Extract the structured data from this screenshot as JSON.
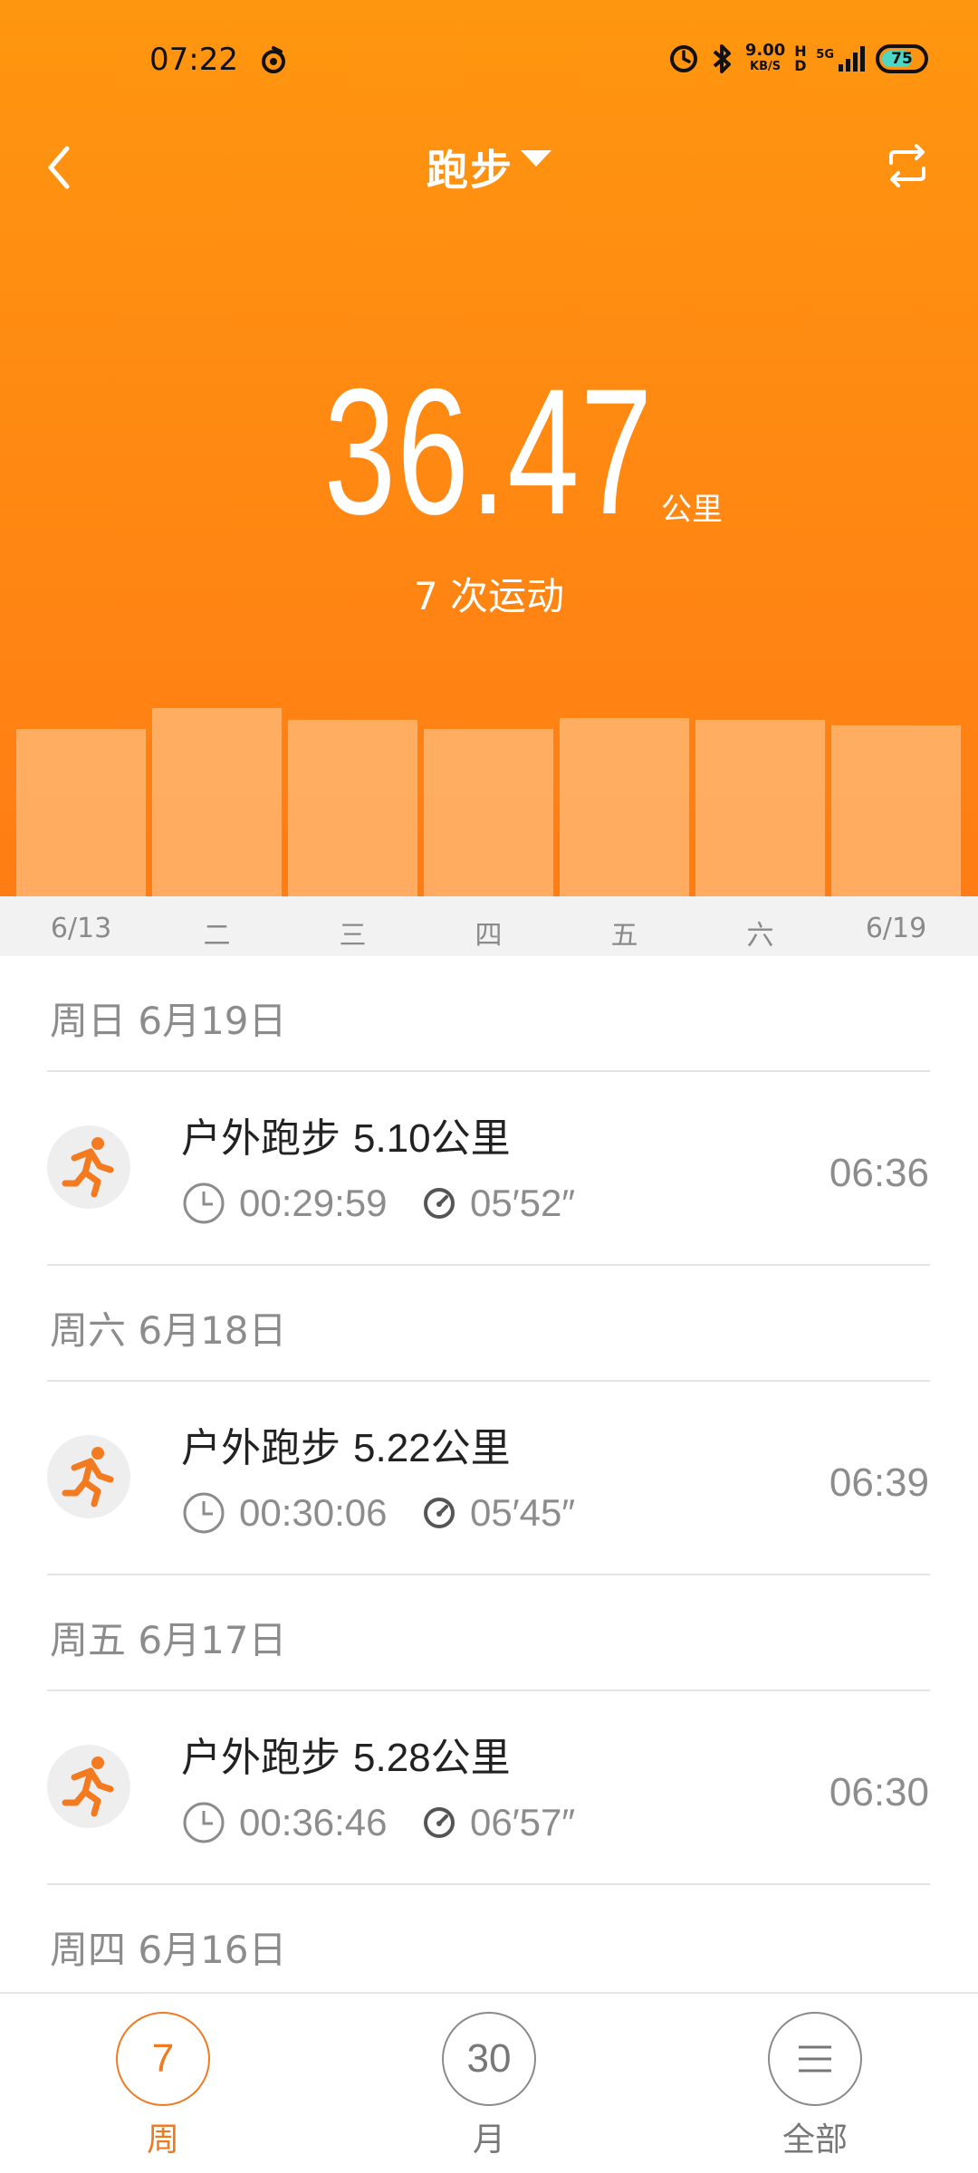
{
  "colors": {
    "accent": "#ff8a12",
    "active_tab": "#f07a22",
    "muted_text": "#8c8c8c"
  },
  "status_bar": {
    "time": "07:22",
    "net_speed_value": "9.00",
    "net_speed_unit": "KB/S",
    "hd_label": "HD",
    "network": "5G",
    "battery": "75",
    "battery_level": 0.75
  },
  "header": {
    "title": "跑步"
  },
  "summary": {
    "distance": "36.47",
    "unit": "公里",
    "workout_count": "7 次运动"
  },
  "weekly_chart": {
    "days": [
      "6/13",
      "二",
      "三",
      "四",
      "五",
      "六",
      "6/19"
    ],
    "relative_heights": [
      0.88,
      0.99,
      0.93,
      0.88,
      0.94,
      0.93,
      0.9
    ]
  },
  "records": [
    {
      "date": "周日 6月19日",
      "type": "户外跑步",
      "distance": "5.10公里",
      "duration": "00:29:59",
      "pace": "05′52″",
      "start_time": "06:36"
    },
    {
      "date": "周六 6月18日",
      "type": "户外跑步",
      "distance": "5.22公里",
      "duration": "00:30:06",
      "pace": "05′45″",
      "start_time": "06:39"
    },
    {
      "date": "周五 6月17日",
      "type": "户外跑步",
      "distance": "5.28公里",
      "duration": "00:36:46",
      "pace": "06′57″",
      "start_time": "06:30"
    },
    {
      "date": "周四 6月16日"
    }
  ],
  "tabs": [
    {
      "number": "7",
      "label": "周",
      "active": true
    },
    {
      "number": "30",
      "label": "月",
      "active": false
    },
    {
      "icon": "menu-icon",
      "label": "全部",
      "active": false
    }
  ]
}
